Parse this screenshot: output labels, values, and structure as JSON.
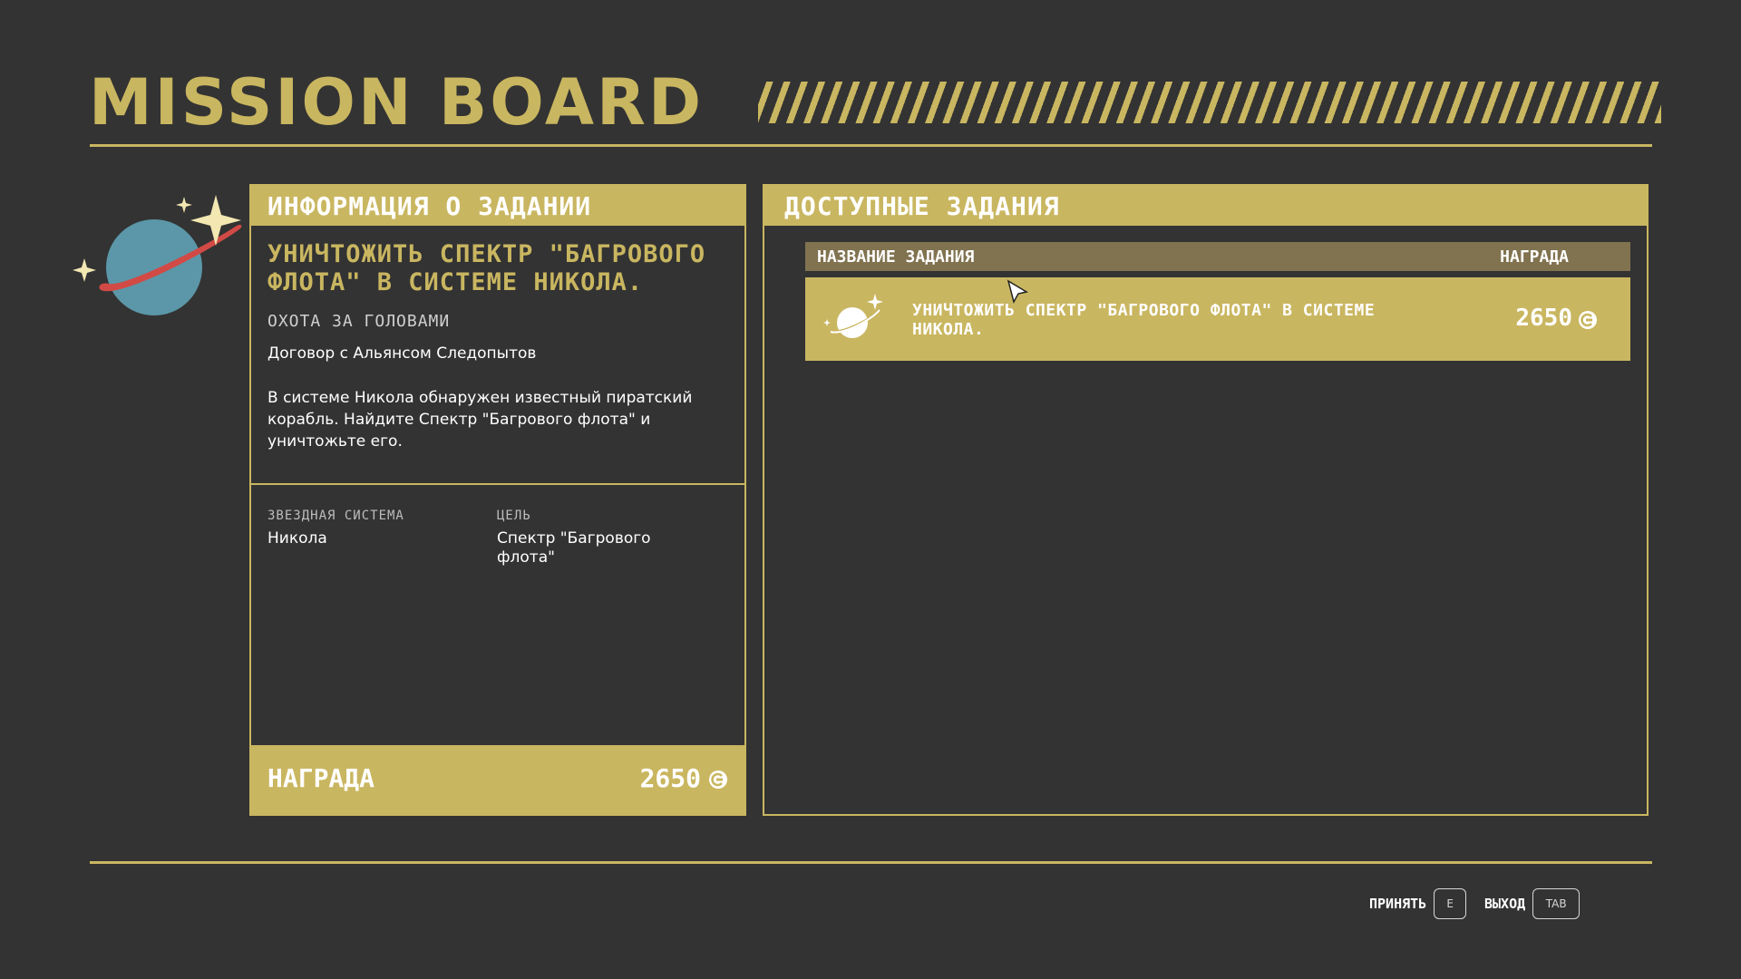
{
  "header": {
    "title": "MISSION BOARD"
  },
  "mission_info": {
    "heading": "ИНФОРМАЦИЯ О ЗАДАНИИ",
    "title": "УНИЧТОЖИТЬ СПЕКТР \"БАГРОВОГО ФЛОТА\" В СИСТЕМЕ НИКОЛА.",
    "type": "ОХОТА ЗА ГОЛОВАМИ",
    "contract": "Договор с Альянсом Следопытов",
    "description": "В системе Никола обнаружен известный пиратский корабль. Найдите Спектр \"Багрового флота\" и уничтожьте его.",
    "star_system_label": "ЗВЕЗДНАЯ СИСТЕМА",
    "star_system_value": "Никола",
    "target_label": "ЦЕЛЬ",
    "target_value": "Спектр \"Багрового флота\"",
    "reward_label": "НАГРАДА",
    "reward_value": "2650"
  },
  "available": {
    "heading": "ДОСТУПНЫЕ ЗАДАНИЯ",
    "col_name": "НАЗВАНИЕ ЗАДАНИЯ",
    "col_reward": "НАГРАДА",
    "missions": [
      {
        "title": "УНИЧТОЖИТЬ СПЕКТР \"БАГРОВОГО ФЛОТА\" В СИСТЕМЕ НИКОЛА.",
        "reward": "2650",
        "icon": "planet-icon"
      }
    ]
  },
  "footer": {
    "accept_label": "ПРИНЯТЬ",
    "accept_key": "E",
    "exit_label": "ВЫХОД",
    "exit_key": "TAB"
  },
  "colors": {
    "background": "#333333",
    "accent": "#c9b660",
    "list_header": "#817350",
    "planet": "#5b97a8",
    "ring": "#d24a45",
    "star": "#f3e7b2"
  }
}
